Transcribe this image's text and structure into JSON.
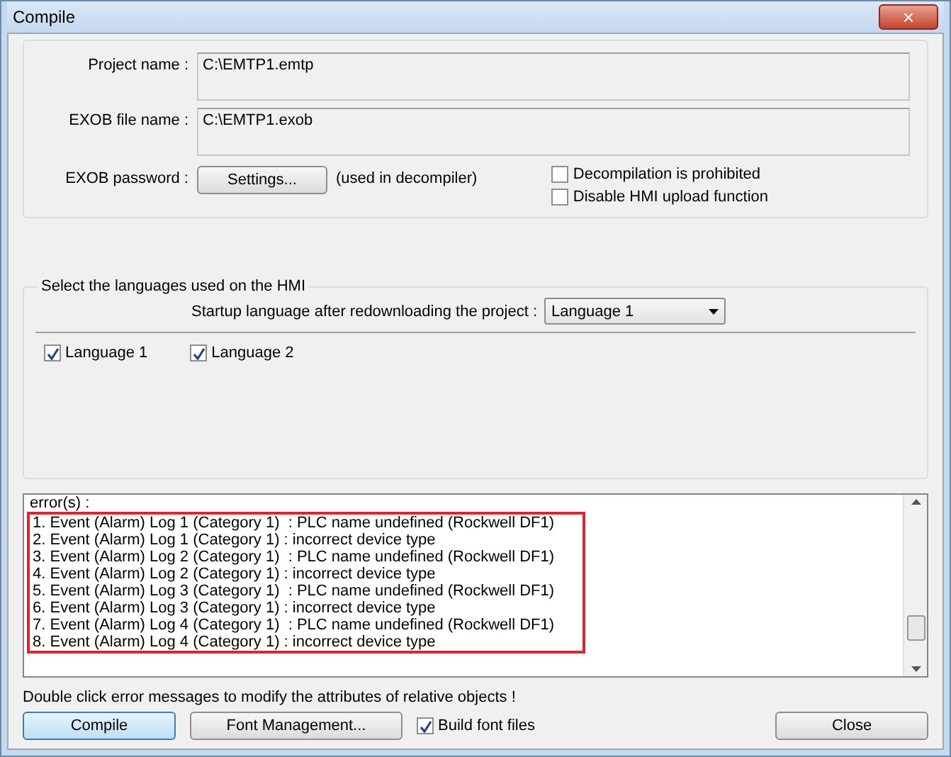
{
  "window": {
    "title": "Compile",
    "close": "×"
  },
  "files": [
    {
      "label": "Project name :",
      "value": "C:\\EMTP1.emtp"
    },
    {
      "label": "EXOB file name :",
      "value": "C:\\EMTP1.exob"
    }
  ],
  "password": {
    "label": "EXOB password :",
    "button": "Settings...",
    "note": "(used in decompiler)"
  },
  "options": [
    {
      "label": "Decompilation is prohibited",
      "checked": false
    },
    {
      "label": "Disable HMI upload function",
      "checked": false
    }
  ],
  "languages": {
    "title": "Select the languages used on the HMI",
    "startup_label": "Startup language after redownloading the project :",
    "startup_value": "Language 1",
    "items": [
      {
        "label": "Language 1",
        "checked": true
      },
      {
        "label": "Language 2",
        "checked": true
      }
    ]
  },
  "errors": {
    "heading": "error(s) :",
    "lines": [
      "1. Event (Alarm) Log 1 (Category 1)  : PLC name undefined (Rockwell DF1)",
      "2. Event (Alarm) Log 1 (Category 1) : incorrect device type",
      "3. Event (Alarm) Log 2 (Category 1)  : PLC name undefined (Rockwell DF1)",
      "4. Event (Alarm) Log 2 (Category 1) : incorrect device type",
      "5. Event (Alarm) Log 3 (Category 1)  : PLC name undefined (Rockwell DF1)",
      "6. Event (Alarm) Log 3 (Category 1) : incorrect device type",
      "7. Event (Alarm) Log 4 (Category 1)  : PLC name undefined (Rockwell DF1)",
      "8. Event (Alarm) Log 4 (Category 1) : incorrect device type"
    ]
  },
  "hint": "Double click error messages to modify the attributes of relative objects !",
  "buttons": {
    "compile": "Compile",
    "fonts": "Font Management...",
    "build": {
      "label": "Build font files",
      "checked": true
    },
    "close": "Close"
  }
}
